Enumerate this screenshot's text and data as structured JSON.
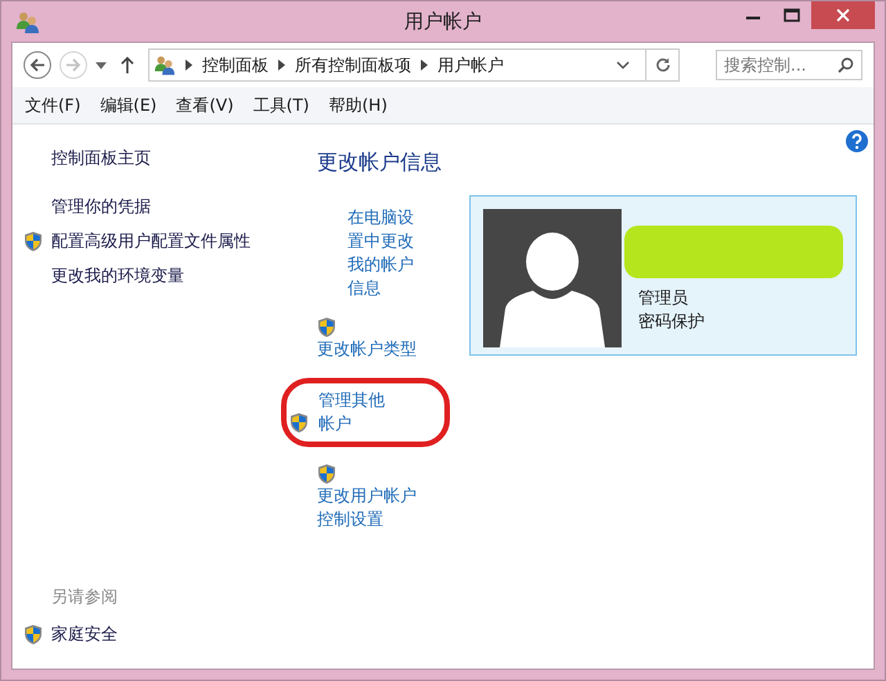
{
  "window": {
    "title": "用户帐户"
  },
  "nav": {
    "breadcrumbs": [
      "控制面板",
      "所有控制面板项",
      "用户帐户"
    ],
    "back_disabled": false,
    "forward_disabled": true,
    "search": {
      "placeholder": "搜索控制..."
    }
  },
  "menu": [
    "文件(F)",
    "编辑(E)",
    "查看(V)",
    "工具(T)",
    "帮助(H)"
  ],
  "sidebar": {
    "items": [
      {
        "label": "控制面板主页",
        "shield": false
      },
      {
        "label": "管理你的凭据",
        "shield": false
      },
      {
        "label": "配置高级用户配置文件属性",
        "shield": true
      },
      {
        "label": "更改我的环境变量",
        "shield": false
      }
    ],
    "see_also": {
      "heading": "另请参阅",
      "items": [
        {
          "label": "家庭安全",
          "shield": true
        }
      ]
    }
  },
  "main": {
    "heading": "更改帐户信息",
    "links": [
      {
        "label": "在电脑设置中更改我的帐户信息",
        "kind": "indented",
        "shield": false,
        "highlighted": false
      },
      {
        "label": "更改帐户类型",
        "kind": "stacked",
        "shield": true,
        "highlighted": false
      },
      {
        "label": "管理其他帐户",
        "kind": "indented",
        "shield": true,
        "highlighted": true
      },
      {
        "label": "更改用户帐户控制设置",
        "kind": "stacked",
        "shield": true,
        "highlighted": false
      }
    ],
    "account": {
      "name_redacted": true,
      "lines": [
        "管理员",
        "密码保护"
      ]
    }
  }
}
